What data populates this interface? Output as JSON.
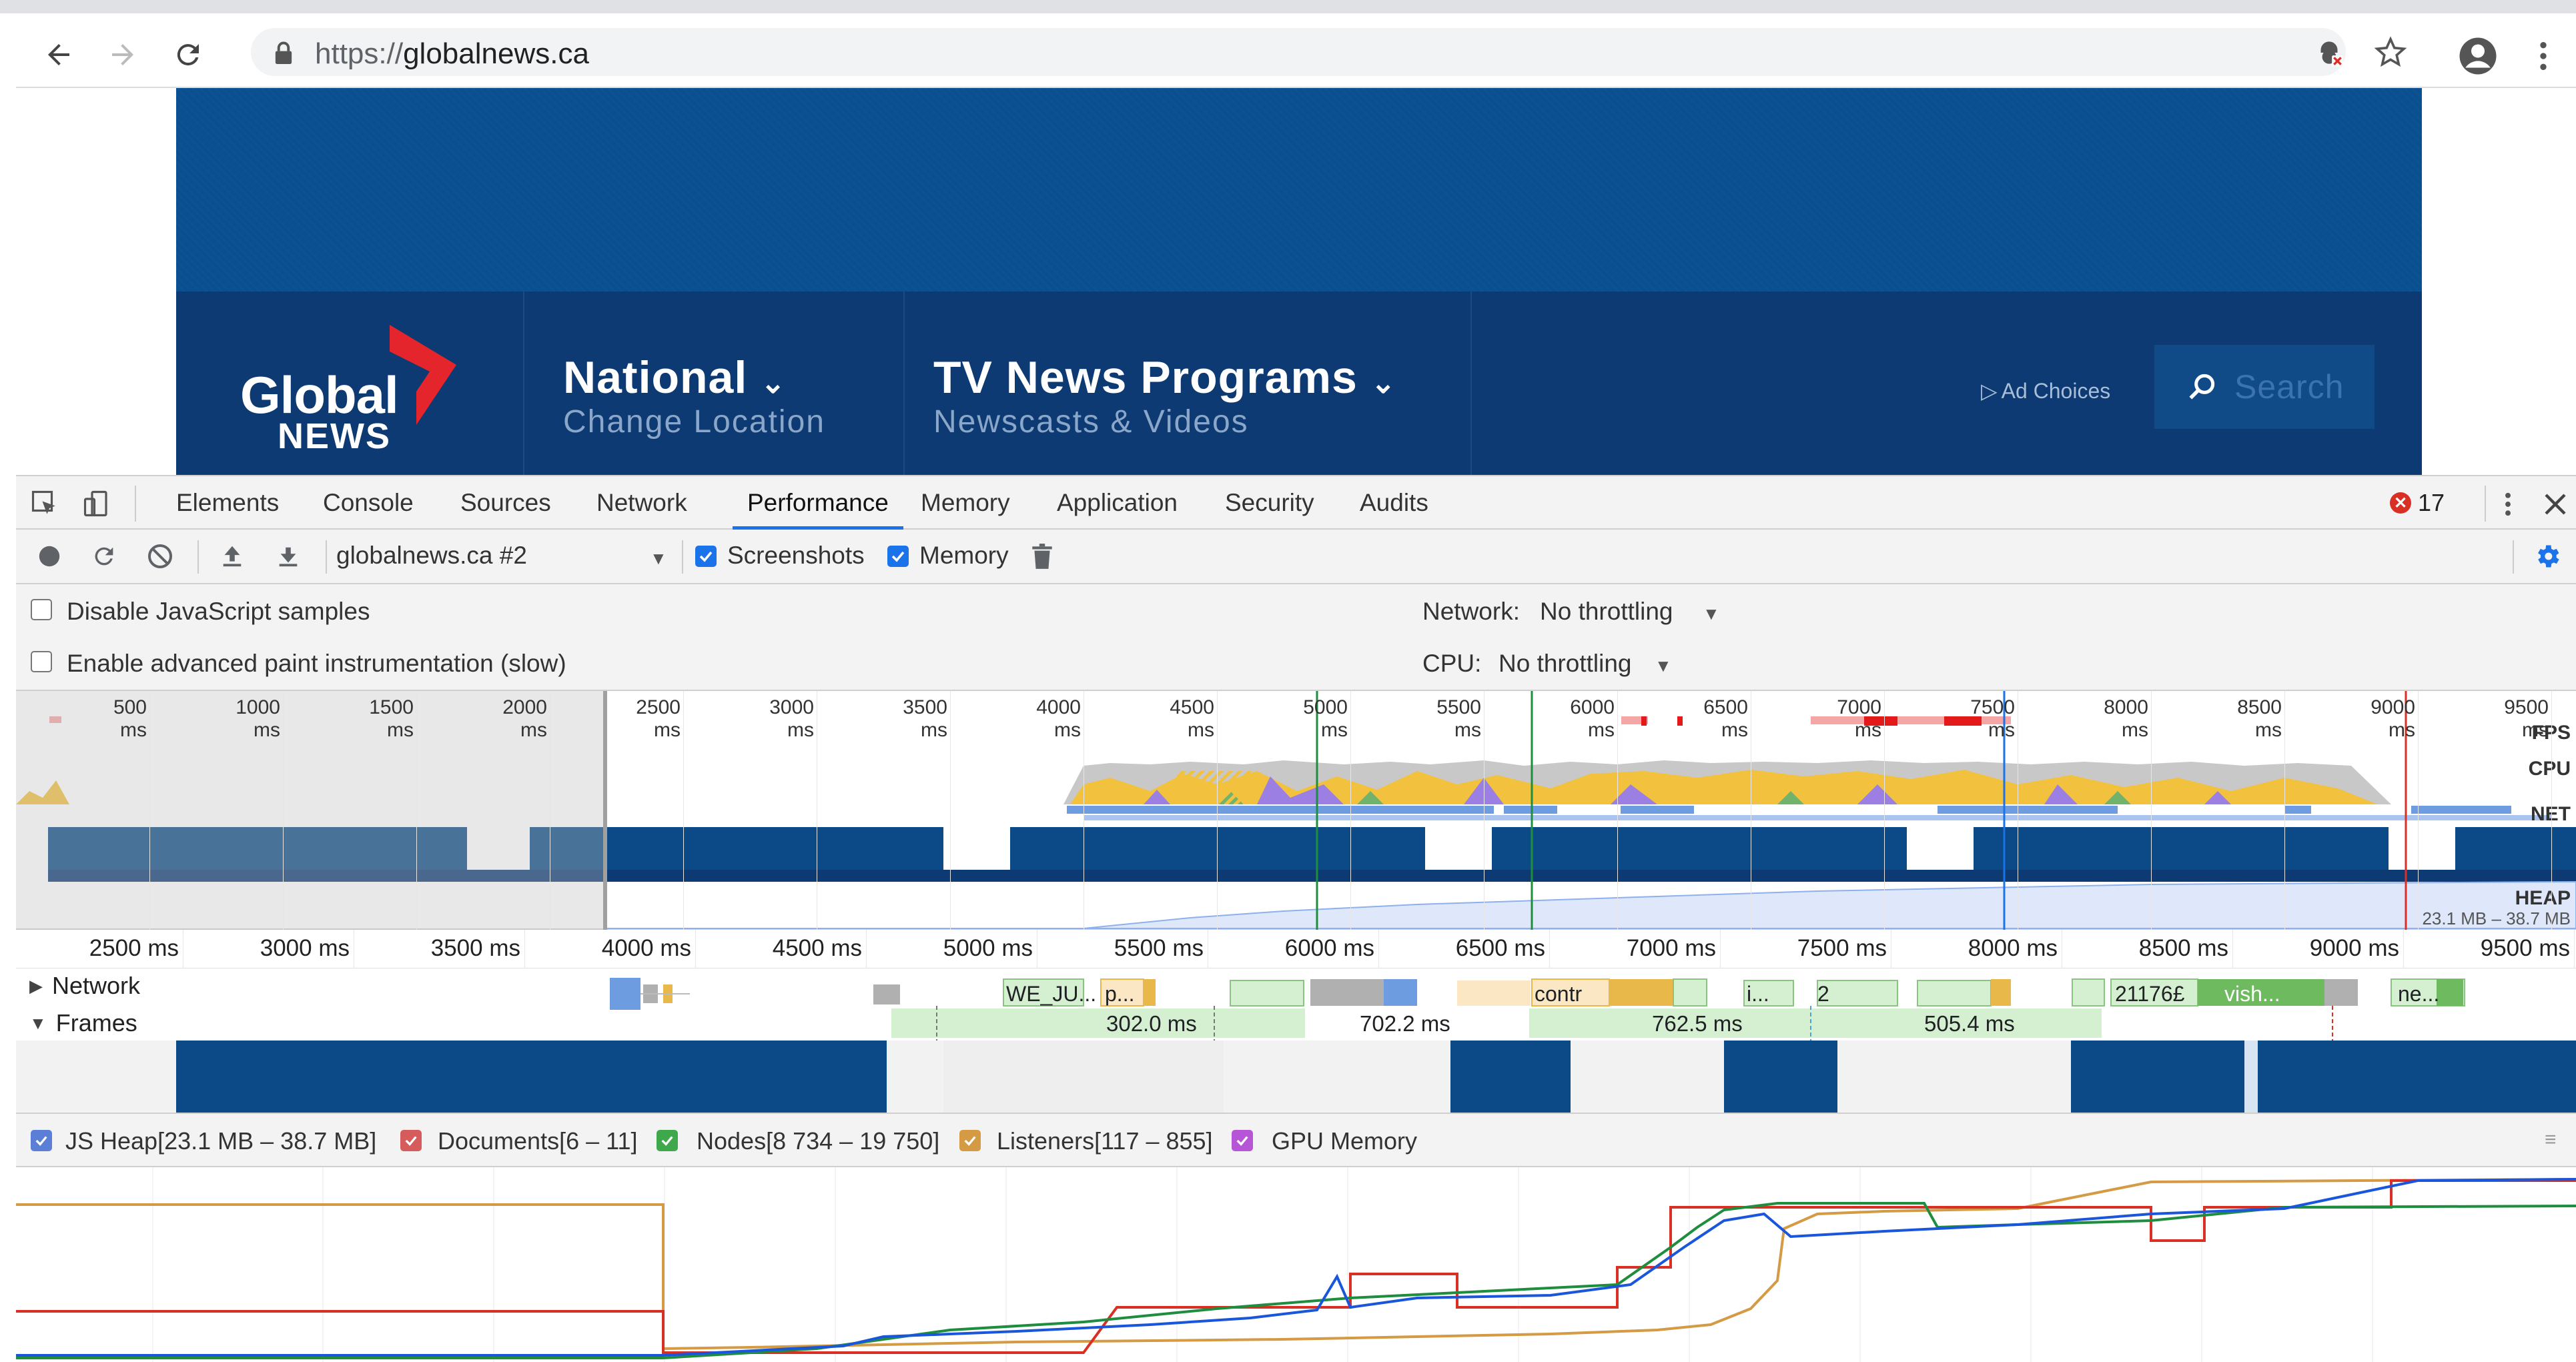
{
  "browser": {
    "url_prefix": "https://",
    "url_domain": "globalnews.ca",
    "icons": [
      "back-icon",
      "forward-icon",
      "reload-icon",
      "lock-icon",
      "blocked-content-icon",
      "star-icon",
      "profile-icon",
      "menu-icon"
    ]
  },
  "site": {
    "logo_line1": "Global",
    "logo_line2": "NEWS",
    "nav": [
      {
        "title": "National",
        "subtitle": "Change Location"
      },
      {
        "title": "TV News Programs",
        "subtitle": "Newscasts & Videos"
      }
    ],
    "ad_choices": "Ad Choices",
    "search_label": "Search",
    "colors": {
      "banner": "#0a4f8f",
      "nav": "#0d3a73",
      "logo_accent": "#e4252c"
    }
  },
  "devtools": {
    "tabs": [
      "Elements",
      "Console",
      "Sources",
      "Network",
      "Performance",
      "Memory",
      "Application",
      "Security",
      "Audits"
    ],
    "active_tab": "Performance",
    "error_count": "17",
    "recording_select": "globalnews.ca #2",
    "screenshots_label": "Screenshots",
    "memory_label": "Memory",
    "disable_js_label": "Disable JavaScript samples",
    "advanced_paint_label": "Enable advanced paint instrumentation (slow)",
    "network_label": "Network:",
    "network_value": "No throttling",
    "cpu_label": "CPU:",
    "cpu_value": "No throttling",
    "overview_ticks": [
      "500 ms",
      "1000 ms",
      "1500 ms",
      "2000 ms",
      "2500 ms",
      "3000 ms",
      "3500 ms",
      "4000 ms",
      "4500 ms",
      "5000 ms",
      "5500 ms",
      "6000 ms",
      "6500 ms",
      "7000 ms",
      "7500 ms",
      "8000 ms",
      "8500 ms",
      "9000 ms",
      "9500 ms"
    ],
    "overview_rows": [
      "FPS",
      "CPU",
      "NET",
      "HEAP"
    ],
    "heap_range": "23.1 MB – 38.7 MB",
    "timeline_ticks": [
      "2500 ms",
      "3000 ms",
      "3500 ms",
      "4000 ms",
      "4500 ms",
      "5000 ms",
      "5500 ms",
      "6000 ms",
      "6500 ms",
      "7000 ms",
      "7500 ms",
      "8000 ms",
      "8500 ms",
      "9000 ms",
      "9500 ms"
    ],
    "network_track": "Network",
    "frames_track": "Frames",
    "network_items": [
      "WE_JU...",
      "p...",
      "contr",
      "i...",
      "2",
      "21176£",
      "vish...",
      "ne..."
    ],
    "frame_durations": [
      "302.0 ms",
      "702.2 ms",
      "762.5 ms",
      "505.4 ms"
    ],
    "counters": [
      {
        "label": "JS Heap[23.1 MB – 38.7 MB]",
        "color": "#1a73e8"
      },
      {
        "label": "Documents[6 – 11]",
        "color": "#d93025"
      },
      {
        "label": "Nodes[8 734 – 19 750]",
        "color": "#1e8e3e"
      },
      {
        "label": "Listeners[117 – 855]",
        "color": "#c77b10"
      },
      {
        "label": "GPU Memory",
        "color": "#a142f4"
      }
    ]
  }
}
